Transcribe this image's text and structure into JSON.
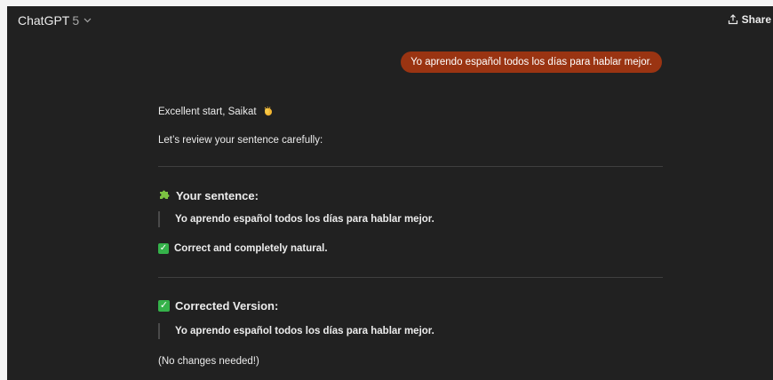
{
  "header": {
    "model_name": "ChatGPT",
    "model_version": "5",
    "share_label": "Share"
  },
  "conversation": {
    "user_message": "Yo aprendo español todos los días para hablar mejor.",
    "assistant": {
      "greeting": "Excellent start, Saikat",
      "intro": "Let’s review your sentence carefully:",
      "section1": {
        "icon": "puzzle-piece-icon",
        "heading": "Your sentence:",
        "quote": "Yo aprendo español todos los días para hablar mejor.",
        "verdict": "Correct and completely natural."
      },
      "section2": {
        "icon": "check-box-icon",
        "heading": "Corrected Version:",
        "quote": "Yo aprendo español todos los días para hablar mejor.",
        "note": "(No changes needed!)"
      }
    }
  },
  "colors": {
    "background": "#212121",
    "user_bubble": "#9a3412",
    "check_green": "#35b24a",
    "puzzle_green": "#7cc242"
  }
}
